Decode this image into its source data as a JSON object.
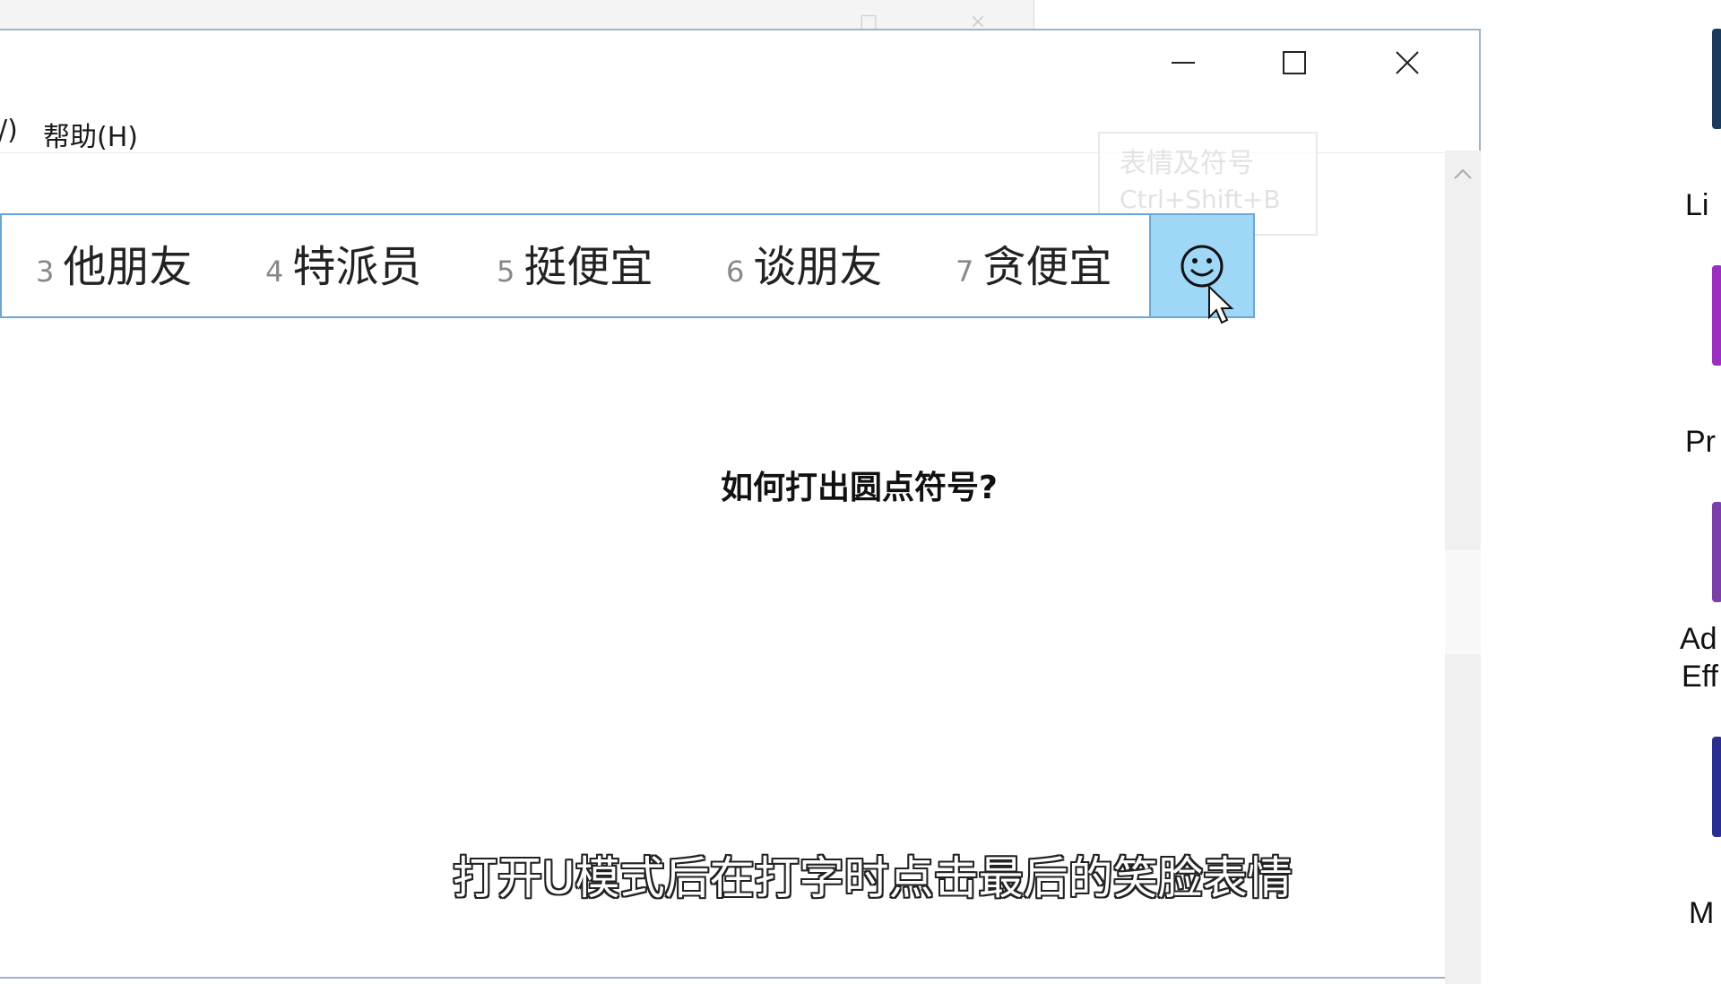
{
  "background_window": {
    "ghost_buttons": [
      "□",
      "×"
    ]
  },
  "menu": {
    "partial_item": "/)",
    "help": "帮助(H)"
  },
  "window_controls": {
    "minimize": "minimize",
    "maximize": "maximize",
    "close": "close"
  },
  "tooltip": {
    "line1": "表情及符号",
    "line2": "Ctrl+Shift+B"
  },
  "ime": {
    "candidates": [
      {
        "num": "3",
        "text": "他朋友"
      },
      {
        "num": "4",
        "text": "特派员"
      },
      {
        "num": "5",
        "text": "挺便宜"
      },
      {
        "num": "6",
        "text": "谈朋友"
      },
      {
        "num": "7",
        "text": "贪便宜"
      }
    ],
    "emoji_button_icon": "smiley-face-icon"
  },
  "question": "如何打出圆点符号?",
  "subtitle": "打开U模式后在打字时点击最后的笑脸表情",
  "desktop": {
    "labels": [
      "Li",
      "Pr",
      "Ad",
      "Eff",
      "M"
    ],
    "icon_colors": [
      "#1b3a5c",
      "#9b2fbf",
      "#7b3fa8",
      "#2a2f8f"
    ]
  }
}
